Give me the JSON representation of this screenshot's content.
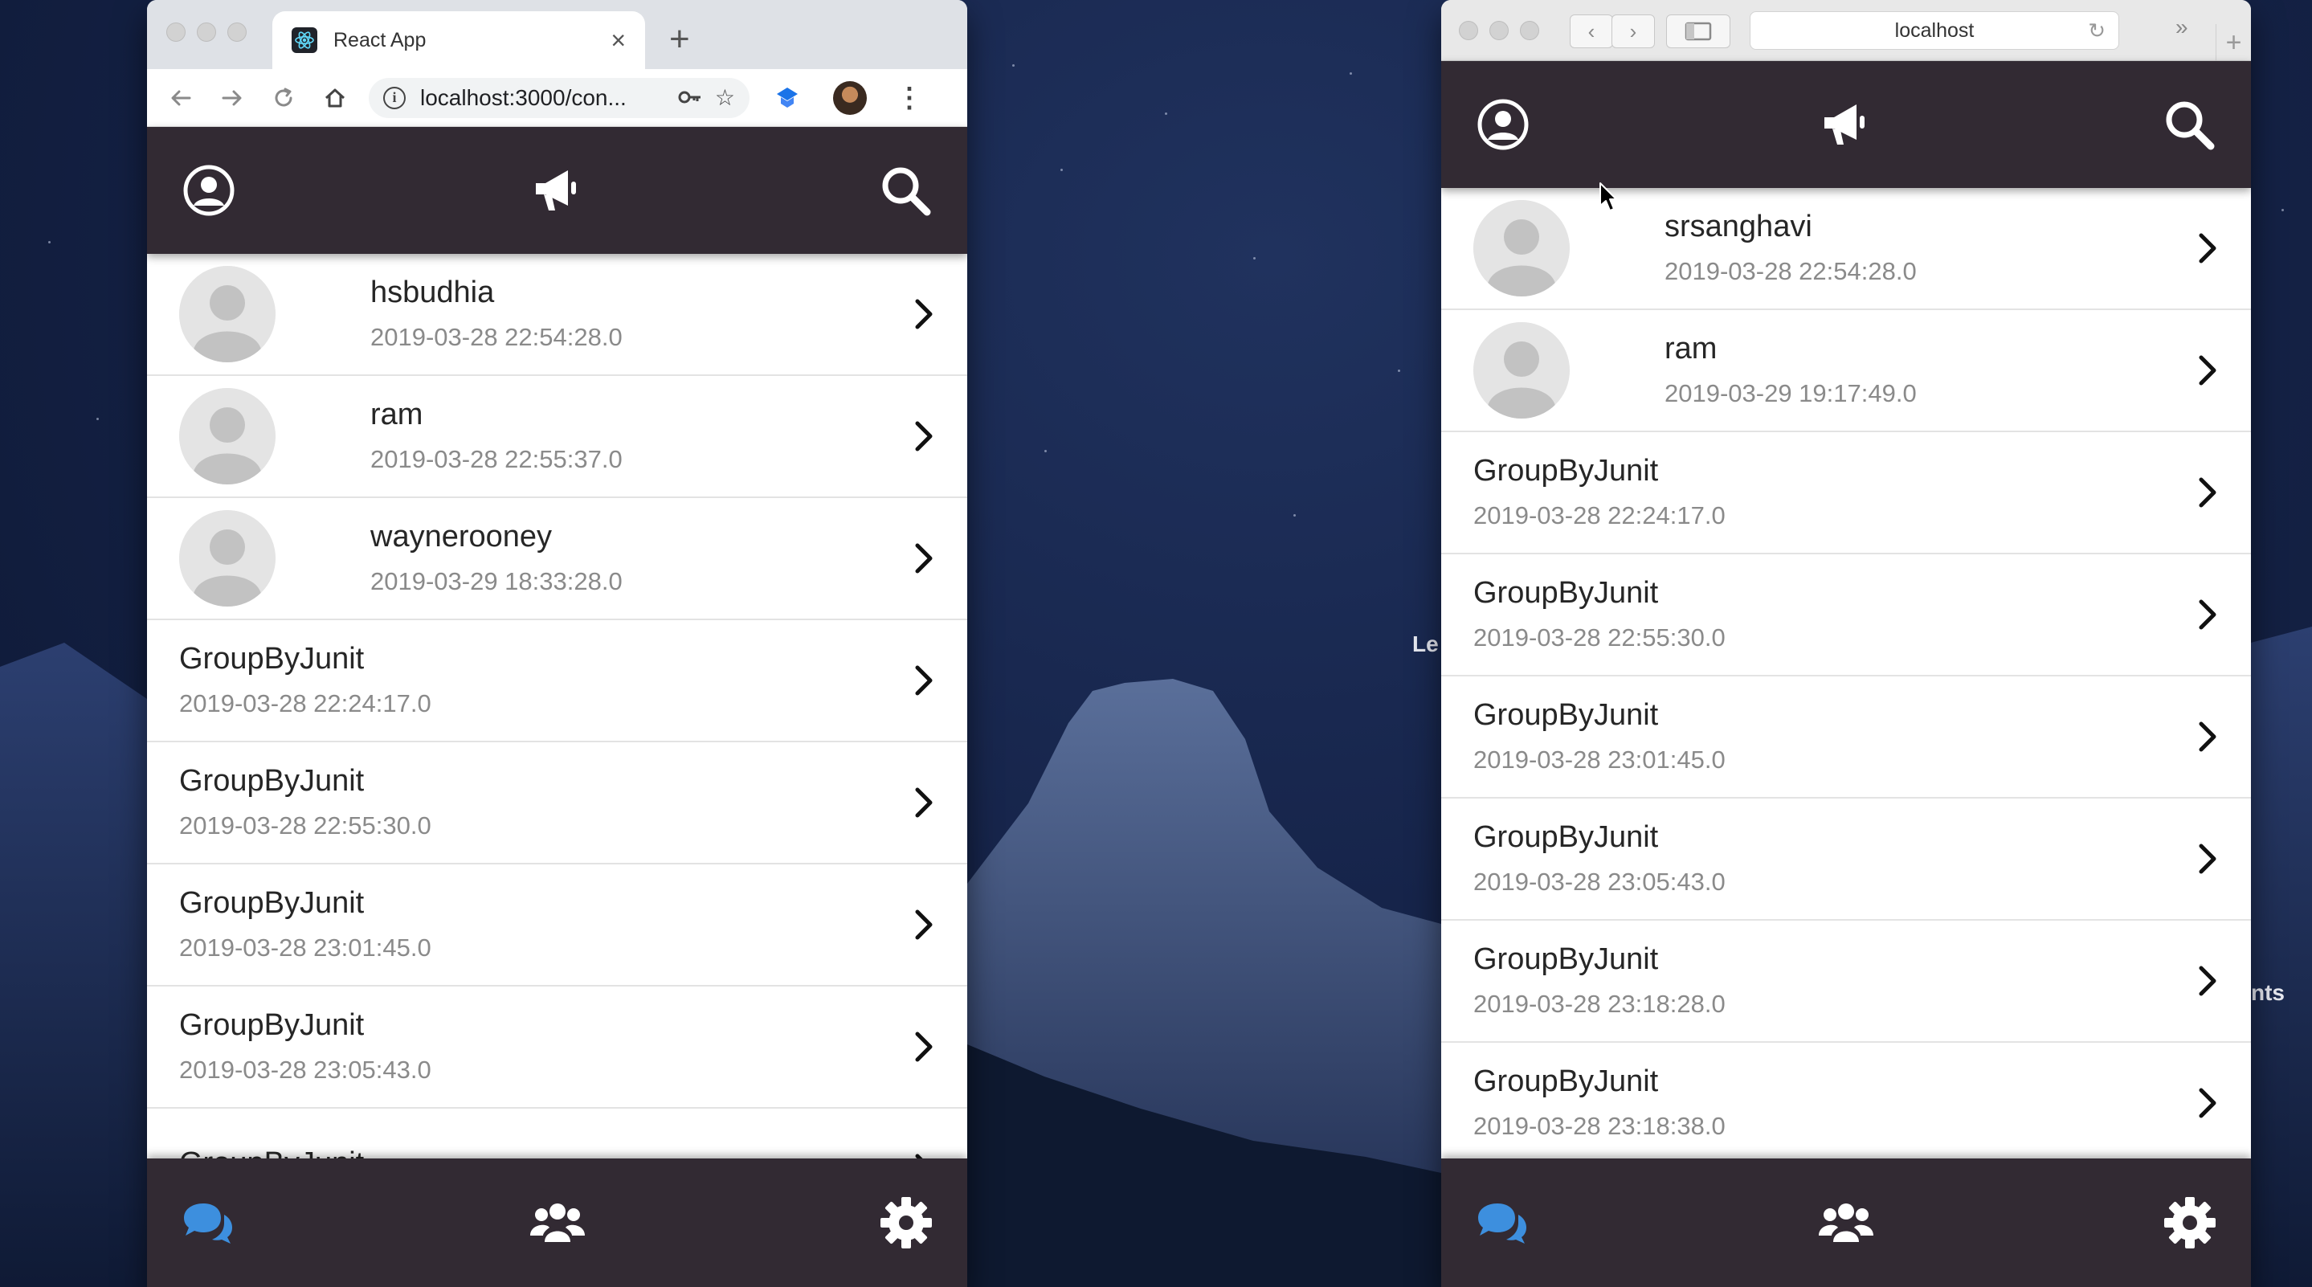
{
  "colors": {
    "app_bar": "#322a33",
    "active_tab": "#3d8fde",
    "icon": "#ffffff",
    "timestamp": "#8a8a8a"
  },
  "desktop": {
    "fragment_left": "Le",
    "fragment_right": "nts"
  },
  "chrome": {
    "tab_title": "React App",
    "url": "localhost:3000/con...",
    "icons": [
      "back-icon",
      "forward-icon",
      "reload-icon",
      "home-icon",
      "info-icon",
      "key-icon",
      "star-icon",
      "extension-icon",
      "profile-avatar",
      "menu-icon"
    ]
  },
  "safari": {
    "address": "localhost"
  },
  "left_app": {
    "header_icons": [
      "user-icon",
      "megaphone-icon",
      "search-icon"
    ],
    "rows": [
      {
        "name": "hsbudhia",
        "time": "2019-03-28 22:54:28.0",
        "avatar": true
      },
      {
        "name": "ram",
        "time": "2019-03-28 22:55:37.0",
        "avatar": true
      },
      {
        "name": "waynerooney",
        "time": "2019-03-29 18:33:28.0",
        "avatar": true
      },
      {
        "name": "GroupByJunit",
        "time": "2019-03-28 22:24:17.0",
        "avatar": false
      },
      {
        "name": "GroupByJunit",
        "time": "2019-03-28 22:55:30.0",
        "avatar": false
      },
      {
        "name": "GroupByJunit",
        "time": "2019-03-28 23:01:45.0",
        "avatar": false
      },
      {
        "name": "GroupByJunit",
        "time": "2019-03-28 23:05:43.0",
        "avatar": false
      },
      {
        "name": "GroupByJunit",
        "time": "",
        "avatar": false
      }
    ],
    "footer_icons": [
      "chat-icon",
      "group-icon",
      "settings-icon"
    ]
  },
  "right_app": {
    "header_icons": [
      "user-icon",
      "megaphone-icon",
      "search-icon"
    ],
    "rows": [
      {
        "name": "srsanghavi",
        "time": "2019-03-28 22:54:28.0",
        "avatar": true
      },
      {
        "name": "ram",
        "time": "2019-03-29 19:17:49.0",
        "avatar": true
      },
      {
        "name": "GroupByJunit",
        "time": "2019-03-28 22:24:17.0",
        "avatar": false
      },
      {
        "name": "GroupByJunit",
        "time": "2019-03-28 22:55:30.0",
        "avatar": false
      },
      {
        "name": "GroupByJunit",
        "time": "2019-03-28 23:01:45.0",
        "avatar": false
      },
      {
        "name": "GroupByJunit",
        "time": "2019-03-28 23:05:43.0",
        "avatar": false
      },
      {
        "name": "GroupByJunit",
        "time": "2019-03-28 23:18:28.0",
        "avatar": false
      },
      {
        "name": "GroupByJunit",
        "time": "2019-03-28 23:18:38.0",
        "avatar": false
      }
    ],
    "footer_icons": [
      "chat-icon",
      "group-icon",
      "settings-icon"
    ]
  }
}
